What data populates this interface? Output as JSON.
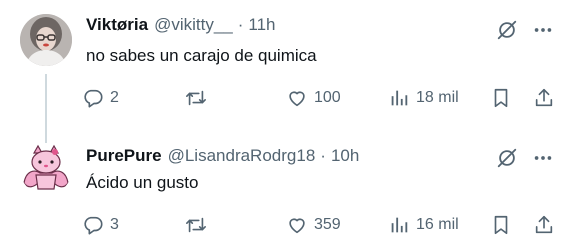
{
  "tweets": [
    {
      "author_name": "Viktøria",
      "handle": "@vikitty__",
      "separator": "·",
      "time": "11h",
      "text": "no sabes un carajo de quimica",
      "replies": "2",
      "retweets": "",
      "likes": "100",
      "views": "18 mil"
    },
    {
      "author_name": "PurePure",
      "handle": "@LisandraRodrg18",
      "separator": "·",
      "time": "10h",
      "text": "Ácido un gusto",
      "replies": "3",
      "retweets": "",
      "likes": "359",
      "views": "16 mil"
    }
  ],
  "icons": {
    "reply": "reply-icon",
    "retweet": "retweet-icon",
    "like": "heart-icon",
    "views": "views-chart-icon",
    "bookmark": "bookmark-icon",
    "share": "share-icon",
    "grok": "grok-icon",
    "more": "more-icon"
  },
  "colors": {
    "text": "#0f1419",
    "secondary": "#536471",
    "thread_line": "#cfd9de",
    "avatar_pink": "#f2a6c9"
  }
}
